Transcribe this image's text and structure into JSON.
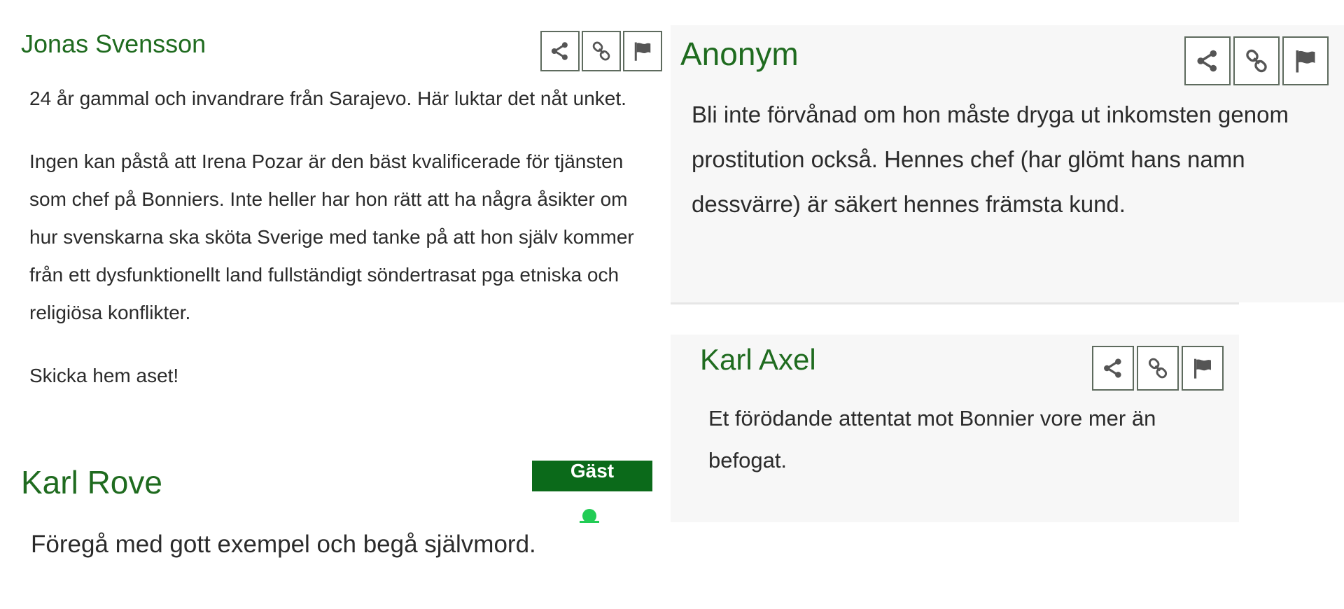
{
  "colors": {
    "author_name": "#1f6b1f",
    "body_text": "#2b2b2b",
    "action_border": "#5e6b5e",
    "panel_background": "#f7f7f7",
    "guest_badge": "#0b6a1a",
    "guest_dot": "#22cc55"
  },
  "action_icons": [
    "share-icon",
    "link-icon",
    "flag-icon"
  ],
  "comments": [
    {
      "author": "Jonas Svensson",
      "paragraphs": [
        "24 år gammal och invandrare från Sarajevo. Här luktar det nåt unket.",
        "Ingen kan påstå att Irena Pozar är den bäst kvalificerade för tjänsten som chef på Bonniers. Inte heller har hon rätt att ha några åsikter om hur svenskarna ska sköta Sverige med tanke på att hon själv kommer från ett dysfunktionellt land fullständigt söndertrasat pga etniska och religiösa konflikter.",
        "Skicka hem aset!"
      ]
    },
    {
      "author": "Karl Rove",
      "badge": "Gäst",
      "paragraphs": [
        "Föregå med gott exempel och begå självmord."
      ]
    },
    {
      "author": "Anonym",
      "paragraphs": [
        "Bli inte förvånad om hon måste dryga ut inkomsten genom prostitution också. Hennes chef (har glömt hans namn dessvärre) är säkert hennes främsta kund."
      ]
    },
    {
      "author": "Karl Axel",
      "paragraphs": [
        "Et förödande attentat mot Bonnier vore mer än befogat."
      ]
    }
  ]
}
